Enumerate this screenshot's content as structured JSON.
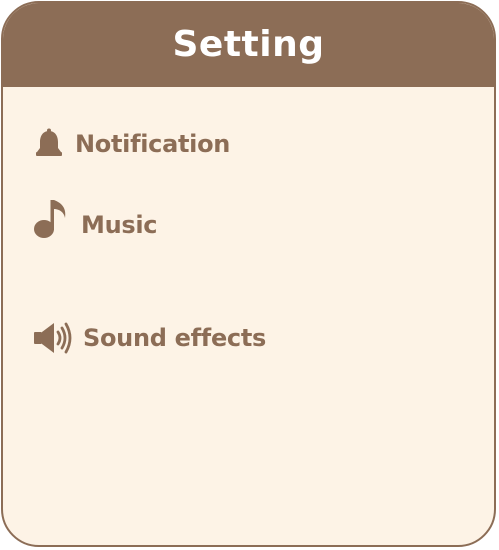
{
  "header": {
    "title": "Setting"
  },
  "settings": {
    "items": [
      {
        "label": "Notification",
        "icon": "bell-icon"
      },
      {
        "label": "Music",
        "icon": "music-note-icon"
      },
      {
        "label": "Sound effects",
        "icon": "speaker-icon"
      }
    ]
  },
  "colors": {
    "accent": "#8c6d56",
    "background": "#fdf3e6",
    "header_text": "#ffffff"
  }
}
